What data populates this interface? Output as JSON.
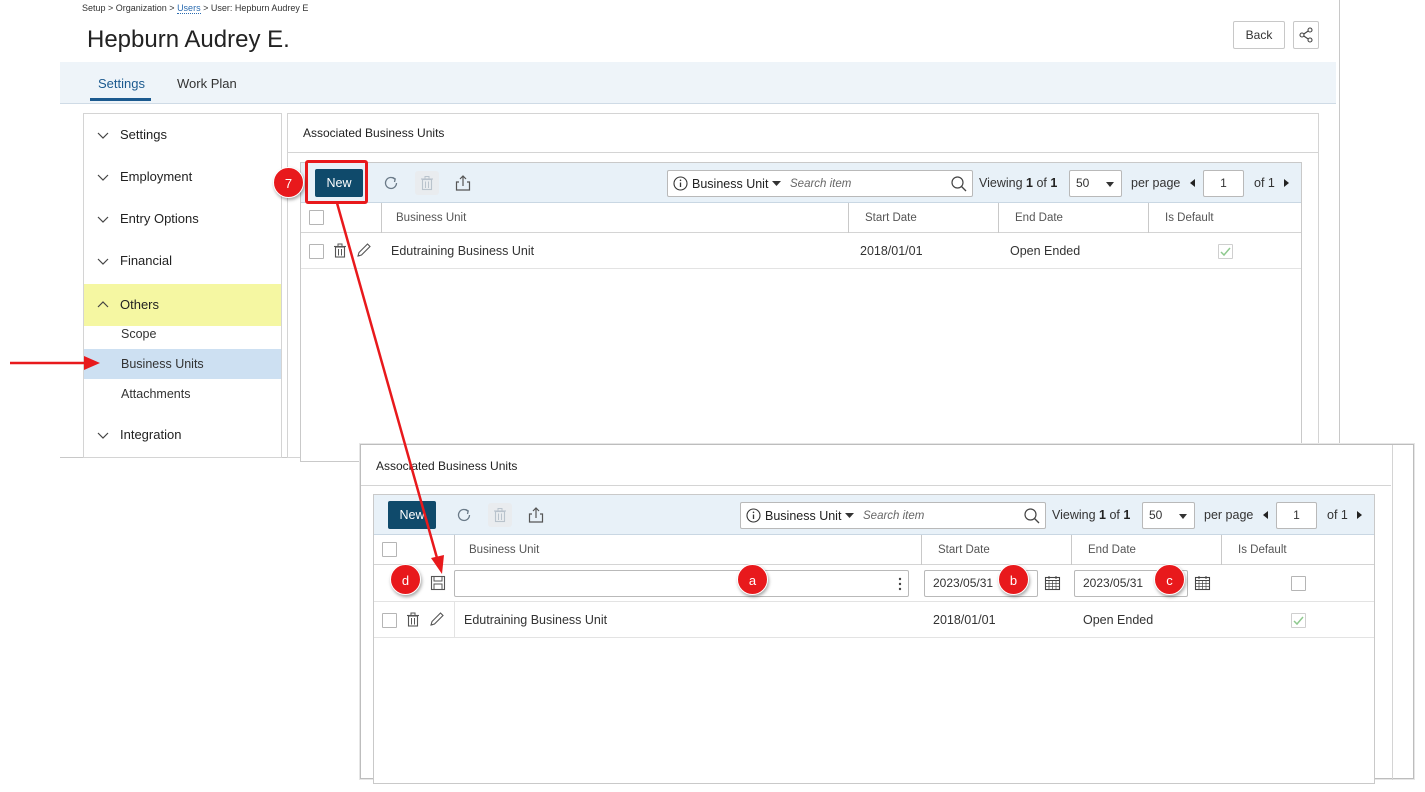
{
  "breadcrumb": {
    "part1": "Setup > Organization > ",
    "link": "Users",
    "part2": " > User: Hepburn Audrey E"
  },
  "page_title": "Hepburn Audrey E.",
  "header_buttons": {
    "back": "Back"
  },
  "tabs": [
    {
      "label": "Settings",
      "active": true
    },
    {
      "label": "Work Plan",
      "active": false
    }
  ],
  "sidebar": {
    "sections": [
      {
        "label": "Settings"
      },
      {
        "label": "Employment"
      },
      {
        "label": "Entry Options"
      },
      {
        "label": "Financial"
      },
      {
        "label": "Others",
        "expanded": true
      },
      {
        "label": "Integration"
      }
    ],
    "sub_items": [
      {
        "label": "Scope"
      },
      {
        "label": "Business Units",
        "selected": true
      },
      {
        "label": "Attachments"
      }
    ]
  },
  "panel": {
    "title": "Associated Business Units",
    "toolbar": {
      "new_label": "New",
      "filter_label": "Business Unit",
      "search_placeholder": "Search item",
      "viewing_prefix": "Viewing",
      "viewing_current": "1",
      "viewing_of": "of",
      "viewing_total": "1",
      "per_page_value": "50",
      "per_page_label": "per page",
      "page_value": "1",
      "page_of": "of 1"
    },
    "columns": {
      "business_unit": "Business Unit",
      "start_date": "Start Date",
      "end_date": "End Date",
      "is_default": "Is Default"
    },
    "rows": [
      {
        "business_unit": "Edutraining Business Unit",
        "start_date": "2018/01/01",
        "end_date": "Open Ended",
        "is_default": true
      }
    ]
  },
  "new_row": {
    "business_unit": "",
    "start_date": "2023/05/31",
    "end_date": "2023/05/31",
    "is_default": false
  },
  "annotations": {
    "step": "7",
    "a": "a",
    "b": "b",
    "c": "c",
    "d": "d"
  },
  "colors": {
    "accent": "#0f4a6b",
    "annotation_red": "#e8191c",
    "sidebar_highlight": "#f5f7a2",
    "sidebar_selected": "#cde0f2",
    "toolbar_bg": "#e8f1f8"
  },
  "icons": [
    "share-icon",
    "chevron-down-icon",
    "chevron-up-icon",
    "refresh-icon",
    "trash-icon",
    "export-icon",
    "info-icon",
    "search-icon",
    "pencil-icon",
    "save-icon",
    "calendar-icon",
    "kebab-icon",
    "checkmark-icon",
    "arrow-right-icon"
  ]
}
